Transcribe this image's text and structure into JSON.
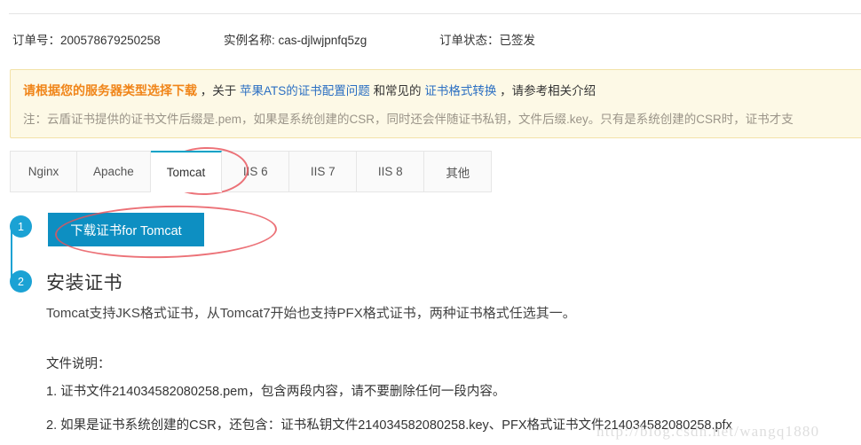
{
  "order": {
    "order_no": "订单号：200578679250258",
    "instance_name": "实例名称: cas-djlwjpnfq5zg",
    "order_status": "订单状态：已签发"
  },
  "banner": {
    "strong": "请根据您的服务器类型选择下载",
    "mid1": "，关于 ",
    "link1": "苹果ATS的证书配置问题",
    "mid2": "和常见的",
    "link2": "证书格式转换",
    "tail": "，请参考相关介绍",
    "note": "注：云盾证书提供的证书文件后缀是.pem，如果是系统创建的CSR，同时还会伴随证书私钥，文件后缀.key。只有是系统创建的CSR时，证书才支",
    "accent_color": "#f08519",
    "link_color": "#2b6fc2",
    "bg_color": "#fdf9e6"
  },
  "tabs": {
    "items": [
      {
        "label": "Nginx",
        "active": false
      },
      {
        "label": "Apache",
        "active": false
      },
      {
        "label": "Tomcat",
        "active": true
      },
      {
        "label": "IIS 6",
        "active": false
      },
      {
        "label": "IIS 7",
        "active": false
      },
      {
        "label": "IIS 8",
        "active": false
      },
      {
        "label": "其他",
        "active": false
      }
    ],
    "active_color": "#00a2c7"
  },
  "steps": {
    "badge_1": "1",
    "badge_2": "2",
    "badge_color": "#1ba2d4"
  },
  "download": {
    "label": "下载证书for Tomcat",
    "bg_color": "#0d8fc2"
  },
  "install": {
    "title": "安装证书",
    "description": "Tomcat支持JKS格式证书，从Tomcat7开始也支持PFX格式证书，两种证书格式任选其一。",
    "file_heading": "文件说明：",
    "file_items": [
      "1. 证书文件214034582080258.pem，包含两段内容，请不要删除任何一段内容。",
      "2. 如果是证书系统创建的CSR，还包含：证书私钥文件214034582080258.key、PFX格式证书文件214034582080258.pfx"
    ]
  },
  "watermark": {
    "text": "http://blog.csdn.net/wangq1880"
  }
}
